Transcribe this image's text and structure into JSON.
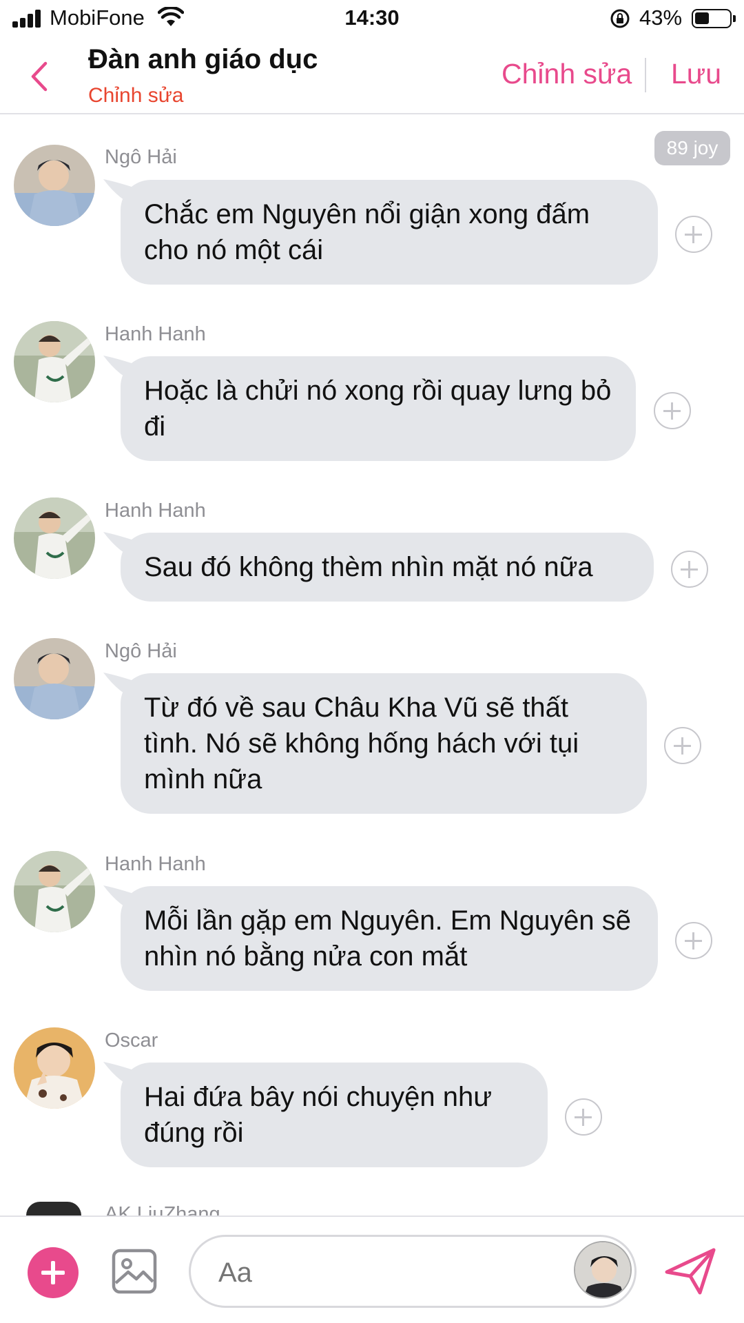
{
  "status_bar": {
    "carrier": "MobiFone",
    "time": "14:30",
    "battery_text": "43%",
    "battery_level": 0.43
  },
  "header": {
    "title": "Đàn anh giáo dục",
    "subtitle": "Chỉnh sửa",
    "edit_label": "Chỉnh sửa",
    "save_label": "Lưu"
  },
  "joy_badge": "89 joy",
  "messages": [
    {
      "sender": "Ngô Hải",
      "text": "Chắc em Nguyên nổi giận xong đấm cho nó một cái",
      "avatar_color": "#8ea6c4"
    },
    {
      "sender": "Hanh Hanh",
      "text": "Hoặc là chửi nó xong rồi quay lưng bỏ đi",
      "avatar_color": "#9aa58c"
    },
    {
      "sender": "Hanh Hanh",
      "text": "Sau đó không thèm nhìn mặt nó nữa",
      "avatar_color": "#9aa58c"
    },
    {
      "sender": "Ngô Hải",
      "text": "Từ đó về sau Châu Kha Vũ sẽ thất tình. Nó sẽ không hống hách với tụi mình nữa",
      "avatar_color": "#8ea6c4"
    },
    {
      "sender": "Hanh Hanh",
      "text": "Mỗi lần gặp em Nguyên. Em Nguyên sẽ nhìn nó bằng nửa con mắt",
      "avatar_color": "#9aa58c"
    },
    {
      "sender": "Oscar",
      "text": "Hai đứa bây nói chuyện như đúng rồi",
      "avatar_color": "#e0a860"
    }
  ],
  "partial_sender": "AK LiuZhang",
  "composer": {
    "placeholder": "Aa"
  },
  "colors": {
    "accent": "#e84a8c",
    "subtitle_red": "#e8452f",
    "bubble": "#e4e6ea"
  }
}
